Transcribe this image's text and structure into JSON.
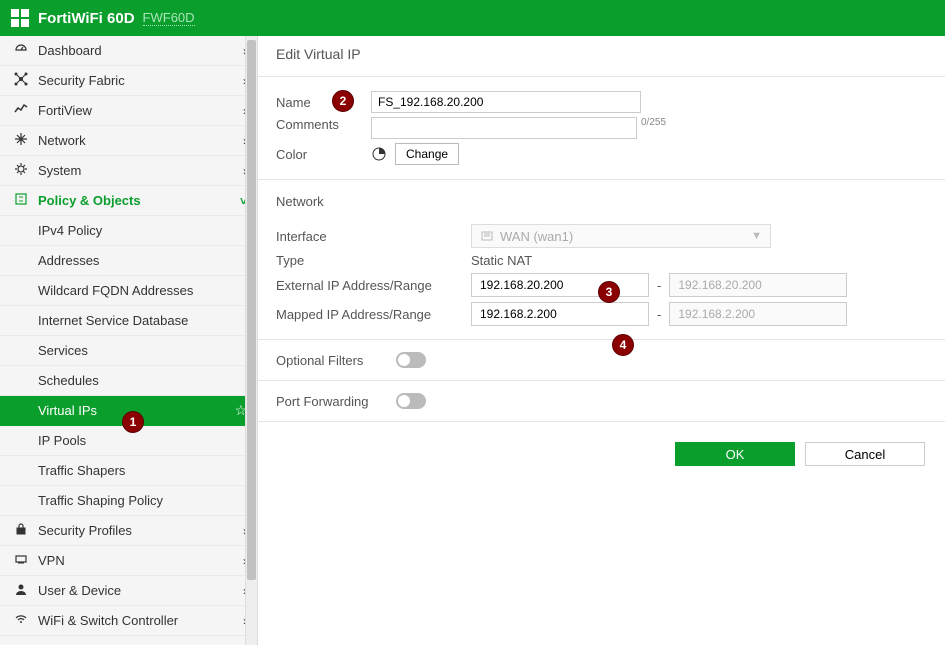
{
  "header": {
    "title": "FortiWiFi 60D",
    "subtitle": "FWF60D"
  },
  "sidebar": {
    "items": [
      {
        "icon": "dashboard",
        "label": "Dashboard",
        "chevron": "›"
      },
      {
        "icon": "fabric",
        "label": "Security Fabric",
        "chevron": "›"
      },
      {
        "icon": "chart",
        "label": "FortiView",
        "chevron": "›"
      },
      {
        "icon": "network",
        "label": "Network",
        "chevron": "›"
      },
      {
        "icon": "gear",
        "label": "System",
        "chevron": "›"
      },
      {
        "icon": "policy",
        "label": "Policy & Objects",
        "chevron": "˅",
        "active": true
      },
      {
        "icon": "lock",
        "label": "Security Profiles",
        "chevron": "›"
      },
      {
        "icon": "vpn",
        "label": "VPN",
        "chevron": "›"
      },
      {
        "icon": "user",
        "label": "User & Device",
        "chevron": "›"
      },
      {
        "icon": "wifi",
        "label": "WiFi & Switch Controller",
        "chevron": "›"
      }
    ],
    "subitems": [
      {
        "label": "IPv4 Policy"
      },
      {
        "label": "Addresses"
      },
      {
        "label": "Wildcard FQDN Addresses"
      },
      {
        "label": "Internet Service Database"
      },
      {
        "label": "Services"
      },
      {
        "label": "Schedules"
      },
      {
        "label": "Virtual IPs",
        "selected": true
      },
      {
        "label": "IP Pools"
      },
      {
        "label": "Traffic Shapers"
      },
      {
        "label": "Traffic Shaping Policy"
      }
    ]
  },
  "page": {
    "title": "Edit Virtual IP",
    "name_label": "Name",
    "name_value": "FS_192.168.20.200",
    "comments_label": "Comments",
    "comments_value": "",
    "char_count": "0/255",
    "color_label": "Color",
    "change_label": "Change",
    "network_section": "Network",
    "interface_label": "Interface",
    "interface_value": "WAN (wan1)",
    "type_label": "Type",
    "type_value": "Static NAT",
    "external_ip_label": "External IP Address/Range",
    "external_ip_start": "192.168.20.200",
    "external_ip_end": "192.168.20.200",
    "mapped_ip_label": "Mapped IP Address/Range",
    "mapped_ip_start": "192.168.2.200",
    "mapped_ip_end": "192.168.2.200",
    "optional_filters_label": "Optional Filters",
    "port_forwarding_label": "Port Forwarding",
    "ok_label": "OK",
    "cancel_label": "Cancel"
  },
  "badges": {
    "b1": "1",
    "b2": "2",
    "b3": "3",
    "b4": "4"
  }
}
